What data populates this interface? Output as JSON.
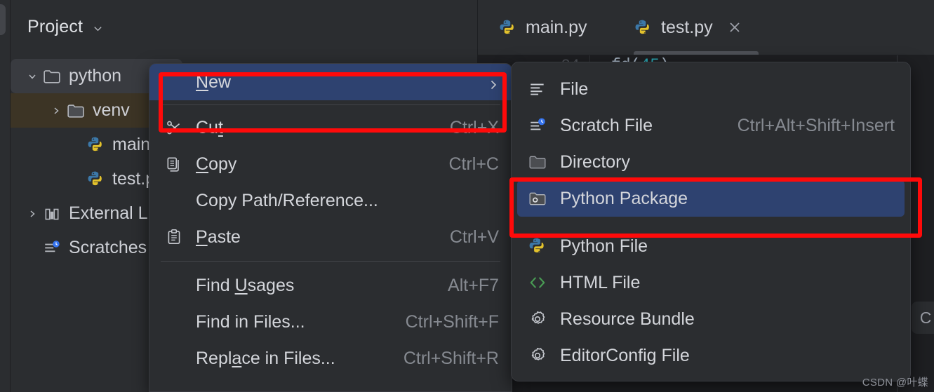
{
  "app": {
    "theme_bg": "#1E1F22",
    "panel_bg": "#2B2D30",
    "selection_blue": "#2E4270",
    "annotation_red": "#FF0A0A"
  },
  "project_panel": {
    "title": "Project",
    "title_chevron": "chevron-down-icon",
    "tree": [
      {
        "label": "python",
        "icon": "folder-icon",
        "arrow": "expanded",
        "depth": 0,
        "highlight": "grey"
      },
      {
        "label": "venv",
        "icon": "folder-icon",
        "arrow": "collapsed",
        "depth": 1,
        "highlight": "brown"
      },
      {
        "label": "main.py",
        "icon": "python-file-icon",
        "arrow": "none",
        "depth": 1,
        "highlight": "none"
      },
      {
        "label": "test.py",
        "icon": "python-file-icon",
        "arrow": "none",
        "depth": 1,
        "highlight": "none"
      },
      {
        "label": "External Libraries",
        "icon": "library-icon",
        "arrow": "collapsed",
        "depth": 0,
        "highlight": "none"
      },
      {
        "label": "Scratches and Consoles",
        "icon": "scratches-icon",
        "arrow": "none",
        "depth": 0,
        "highlight": "none"
      }
    ]
  },
  "editor": {
    "tabs": [
      {
        "label": "main.py",
        "icon": "python-file-icon",
        "active": false,
        "closable": false
      },
      {
        "label": "test.py",
        "icon": "python-file-icon",
        "active": true,
        "closable": true
      }
    ],
    "close_icon": "close-icon",
    "gutter_line_number": "34",
    "code_fragment_prefix": "fd(",
    "code_fragment_number": "45",
    "code_fragment_suffix": ")",
    "right_pill_label": "C",
    "orange_mark": "∧"
  },
  "context_menu": {
    "items": [
      {
        "label": "New",
        "mnemonic": "N",
        "icon": "none",
        "shortcut": "",
        "submenu": true,
        "selected": true,
        "separator_after": true
      },
      {
        "label": "Cut",
        "mnemonic": "t",
        "icon": "scissors-icon",
        "shortcut": "Ctrl+X",
        "submenu": false,
        "selected": false,
        "separator_after": false
      },
      {
        "label": "Copy",
        "mnemonic": "C",
        "icon": "copy-icon",
        "shortcut": "Ctrl+C",
        "submenu": false,
        "selected": false,
        "separator_after": false
      },
      {
        "label": "Copy Path/Reference...",
        "mnemonic": "",
        "icon": "none",
        "shortcut": "",
        "submenu": false,
        "selected": false,
        "separator_after": false
      },
      {
        "label": "Paste",
        "mnemonic": "P",
        "icon": "clipboard-icon",
        "shortcut": "Ctrl+V",
        "submenu": false,
        "selected": false,
        "separator_after": true
      },
      {
        "label": "Find Usages",
        "mnemonic": "U",
        "icon": "none",
        "shortcut": "Alt+F7",
        "submenu": false,
        "selected": false,
        "separator_after": false
      },
      {
        "label": "Find in Files...",
        "mnemonic": "",
        "icon": "none",
        "shortcut": "Ctrl+Shift+F",
        "submenu": false,
        "selected": false,
        "separator_after": false
      },
      {
        "label": "Replace in Files...",
        "mnemonic": "a",
        "icon": "none",
        "shortcut": "Ctrl+Shift+R",
        "submenu": false,
        "selected": false,
        "separator_after": false
      }
    ]
  },
  "submenu": {
    "items": [
      {
        "label": "File",
        "icon": "file-lines-icon",
        "shortcut": "",
        "selected": false
      },
      {
        "label": "Scratch File",
        "icon": "scratch-file-icon",
        "shortcut": "Ctrl+Alt+Shift+Insert",
        "selected": false
      },
      {
        "label": "Directory",
        "icon": "folder-icon",
        "shortcut": "",
        "selected": false
      },
      {
        "label": "Python Package",
        "icon": "python-package-icon",
        "shortcut": "",
        "selected": true
      },
      {
        "label": "Python File",
        "icon": "python-file-icon",
        "shortcut": "",
        "selected": false
      },
      {
        "label": "HTML File",
        "icon": "html-file-icon",
        "shortcut": "",
        "selected": false
      },
      {
        "label": "Resource Bundle",
        "icon": "gear-icon",
        "shortcut": "",
        "selected": false
      },
      {
        "label": "EditorConfig File",
        "icon": "gear-icon",
        "shortcut": "",
        "selected": false
      }
    ]
  },
  "watermark": {
    "text": "CSDN @叶蝶"
  }
}
